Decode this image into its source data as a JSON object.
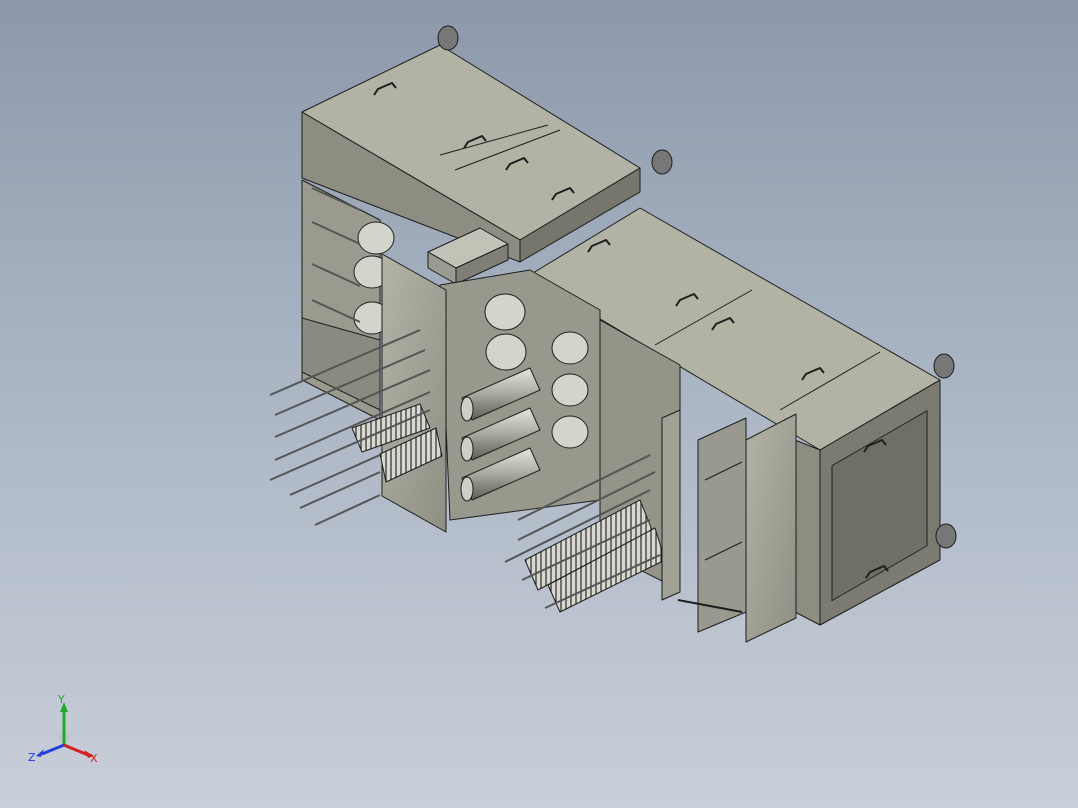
{
  "viewport": {
    "background_top": "#8d99ab",
    "background_bottom": "#c9cfd9",
    "body_color": "#a8a89b",
    "body_shade": "#8e8e82",
    "body_dark": "#6f6f66",
    "edge_color": "#1e1e1e"
  },
  "triad": {
    "x_label": "X",
    "y_label": "Y",
    "z_label": "Z",
    "x_color": "#d42020",
    "y_color": "#1faa2a",
    "z_color": "#2040d8"
  }
}
